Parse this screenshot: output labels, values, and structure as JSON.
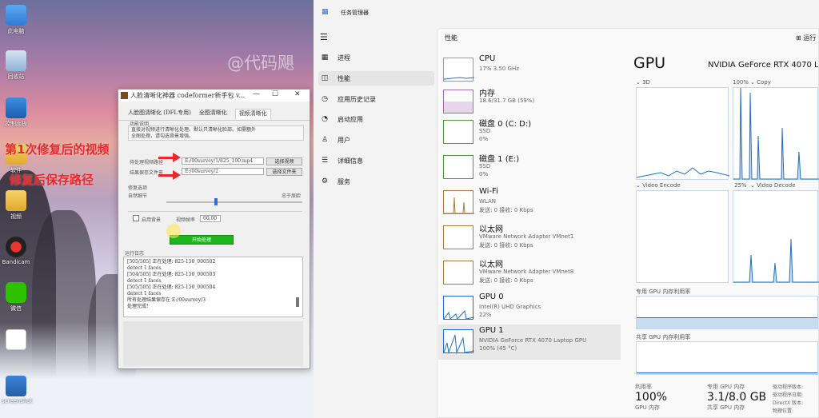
{
  "desktop": {
    "icons": [
      "此电脑",
      "回收站",
      "控制面板",
      "软件",
      "视频",
      "Bandicam",
      "微信",
      "",
      "screenshot"
    ],
    "watermark": "@代码飓",
    "annotation_1": "第1次修复后的视频",
    "annotation_2": "修复后保存路径"
  },
  "app": {
    "title": "人脸清晰化神器 codeformer新手包 v...",
    "window_buttons": [
      "—",
      "☐",
      "✕"
    ],
    "tabs": [
      "人脸图清晰化 (DFL专用)",
      "全图清晰化",
      "视频清晰化"
    ],
    "func_desc_label": "功能说明",
    "func_desc_text": "直接对视频进行清晰化处理。默认只清晰化脸部。如需额外",
    "func_desc_text2": "全图处理，请勾选背景增强。",
    "video_path_label": "待处理视频路径",
    "video_path_value": "E:/00survey/1/825_100.mp4",
    "select_video_btn": "选择视频",
    "save_dir_label": "结果保存文件夹",
    "save_dir_value": "E:/00survey/2",
    "select_folder_btn": "选择文件夹",
    "options_label": "修复选项",
    "quality_low": "自然细节",
    "quality_high": "忠于原脸",
    "bg_enhance_label": "启用背景",
    "fps_label": "视频帧率",
    "fps_value": "60.00",
    "start_button": "开始处理",
    "log_label": "运行日志",
    "log_lines": [
      "[505/505] 正在处理: 825-150_000502",
      "        detect 1 faces",
      "[504/505] 正在处理: 825-150_000503",
      "        detect 1 faces",
      "[505/505] 正在处理: 825-150_000504",
      "        detect 1 faces",
      "所有处理结果保存在 E:/00survey/3",
      "处理完成!"
    ]
  },
  "taskmanager": {
    "title": "任务管理器",
    "nav": [
      "进程",
      "性能",
      "应用历史记录",
      "启动应用",
      "用户",
      "详细信息",
      "服务"
    ],
    "nav_icons": [
      "▦",
      "◫",
      "◷",
      "◔",
      "♙",
      "☰",
      "⚙"
    ],
    "section_title": "性能",
    "run_task": "运行",
    "resources": [
      {
        "name": "CPU",
        "s1": "17%  3.50 GHz",
        "s2": ""
      },
      {
        "name": "内存",
        "s1": "18.6/31.7 GB (59%)",
        "s2": ""
      },
      {
        "name": "磁盘 0 (C: D:)",
        "s1": "SSD",
        "s2": "0%"
      },
      {
        "name": "磁盘 1 (E:)",
        "s1": "SSD",
        "s2": "0%"
      },
      {
        "name": "Wi-Fi",
        "s1": "WLAN",
        "s2": "发送: 0 接收: 0 Kbps"
      },
      {
        "name": "以太网",
        "s1": "VMware Network Adapter VMnet1",
        "s2": "发送: 0 接收: 0 Kbps"
      },
      {
        "name": "以太网",
        "s1": "VMware Network Adapter VMnet8",
        "s2": "发送: 0 接收: 0 Kbps"
      },
      {
        "name": "GPU 0",
        "s1": "Intel(R) UHD Graphics",
        "s2": "22%"
      },
      {
        "name": "GPU 1",
        "s1": "NVIDIA GeForce RTX 4070 Laptop GPU",
        "s2": "100% (45 °C)"
      }
    ],
    "detail": {
      "title": "GPU",
      "model": "NVIDIA GeForce RTX 4070 LA",
      "g1": "3D",
      "g2_pct": "100%",
      "g2": "Copy",
      "g3": "Video Encode",
      "g4_pct": "25%",
      "g4": "Video Decode",
      "dedicated_label": "专用 GPU 内存利用率",
      "shared_label": "共享 GPU 内存利用率",
      "util_label": "利用率",
      "util_value": "100%",
      "ded_mem_label": "专用 GPU 内存",
      "ded_mem_value": "3.1/8.0 GB",
      "gpu_mem_label": "GPU 内存",
      "shared_mem_label": "共享 GPU 内存",
      "right_labels": [
        "驱动程序版本:",
        "驱动程序日期:",
        "DirectX 版本:",
        "物理位置:"
      ]
    }
  }
}
